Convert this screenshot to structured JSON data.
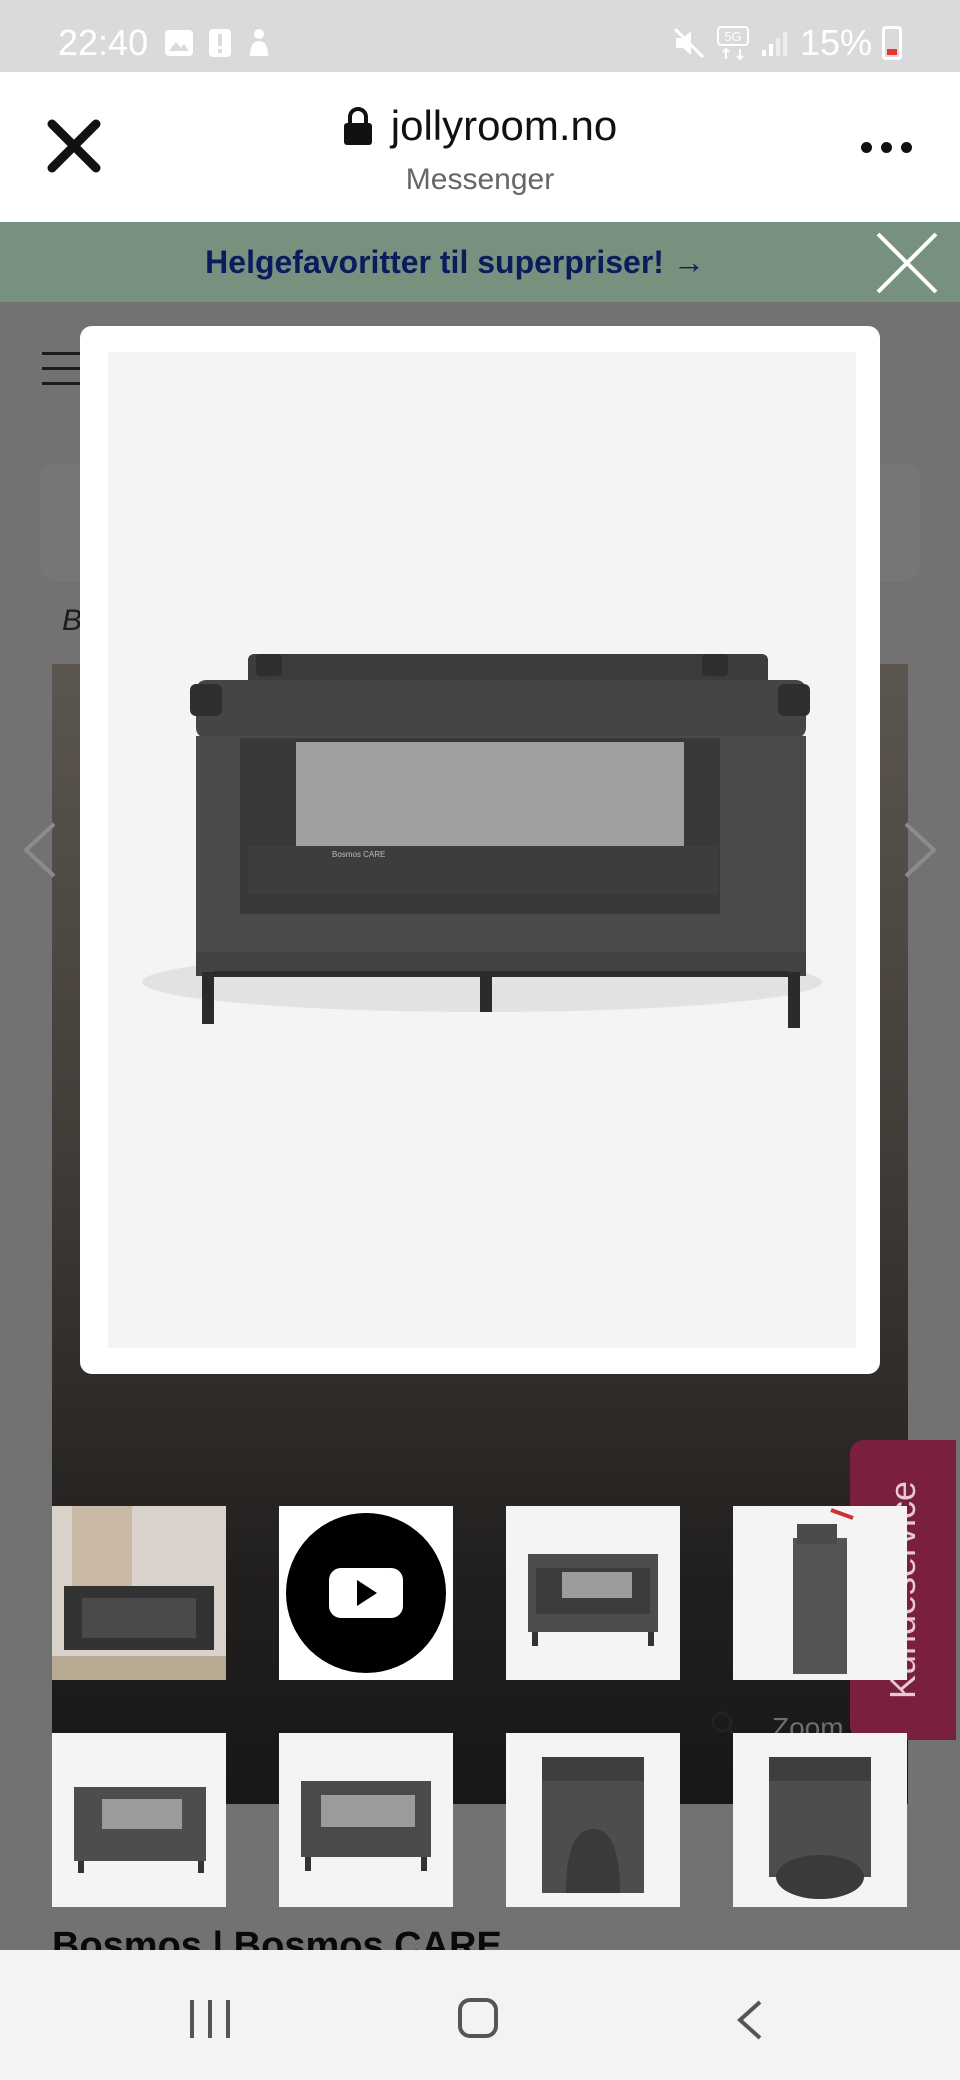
{
  "status_bar": {
    "time": "22:40",
    "battery": "15%",
    "icons": [
      "gallery-icon",
      "alert-icon",
      "accessibility-icon",
      "mute-icon",
      "5g-icon",
      "signal-icon",
      "battery-icon"
    ]
  },
  "browser": {
    "url": "jollyroom.no",
    "subtitle": "Messenger",
    "icons": [
      "close-icon",
      "lock-icon",
      "more-icon"
    ]
  },
  "promo": {
    "text": "Helgefavoritter til superpriser! →",
    "bg_color": "#78917e",
    "text_color": "#0b1b5c"
  },
  "background_page": {
    "breadcrumb_fragment": "B",
    "product_title_fragment": "Bosmos | Bosmos CARE",
    "kundeservice_label": "Kundeservice",
    "kundeservice_color": "#7a1f3d",
    "zoom_label": "Zoom"
  },
  "modal": {
    "image_subject": "travel-cot-dark-grey",
    "image_brand_print": "Bosmos CARE"
  },
  "thumbnails": [
    {
      "name": "thumb-lifestyle",
      "kind": "photo"
    },
    {
      "name": "thumb-video",
      "kind": "video"
    },
    {
      "name": "thumb-cot-front",
      "kind": "photo"
    },
    {
      "name": "thumb-folded",
      "kind": "photo"
    },
    {
      "name": "thumb-cot-side",
      "kind": "photo"
    },
    {
      "name": "thumb-cot-angle",
      "kind": "photo"
    },
    {
      "name": "thumb-cot-end",
      "kind": "photo"
    },
    {
      "name": "thumb-cot-open",
      "kind": "photo"
    }
  ],
  "navbar": {
    "icons": [
      "recents-icon",
      "home-icon",
      "back-icon"
    ]
  }
}
